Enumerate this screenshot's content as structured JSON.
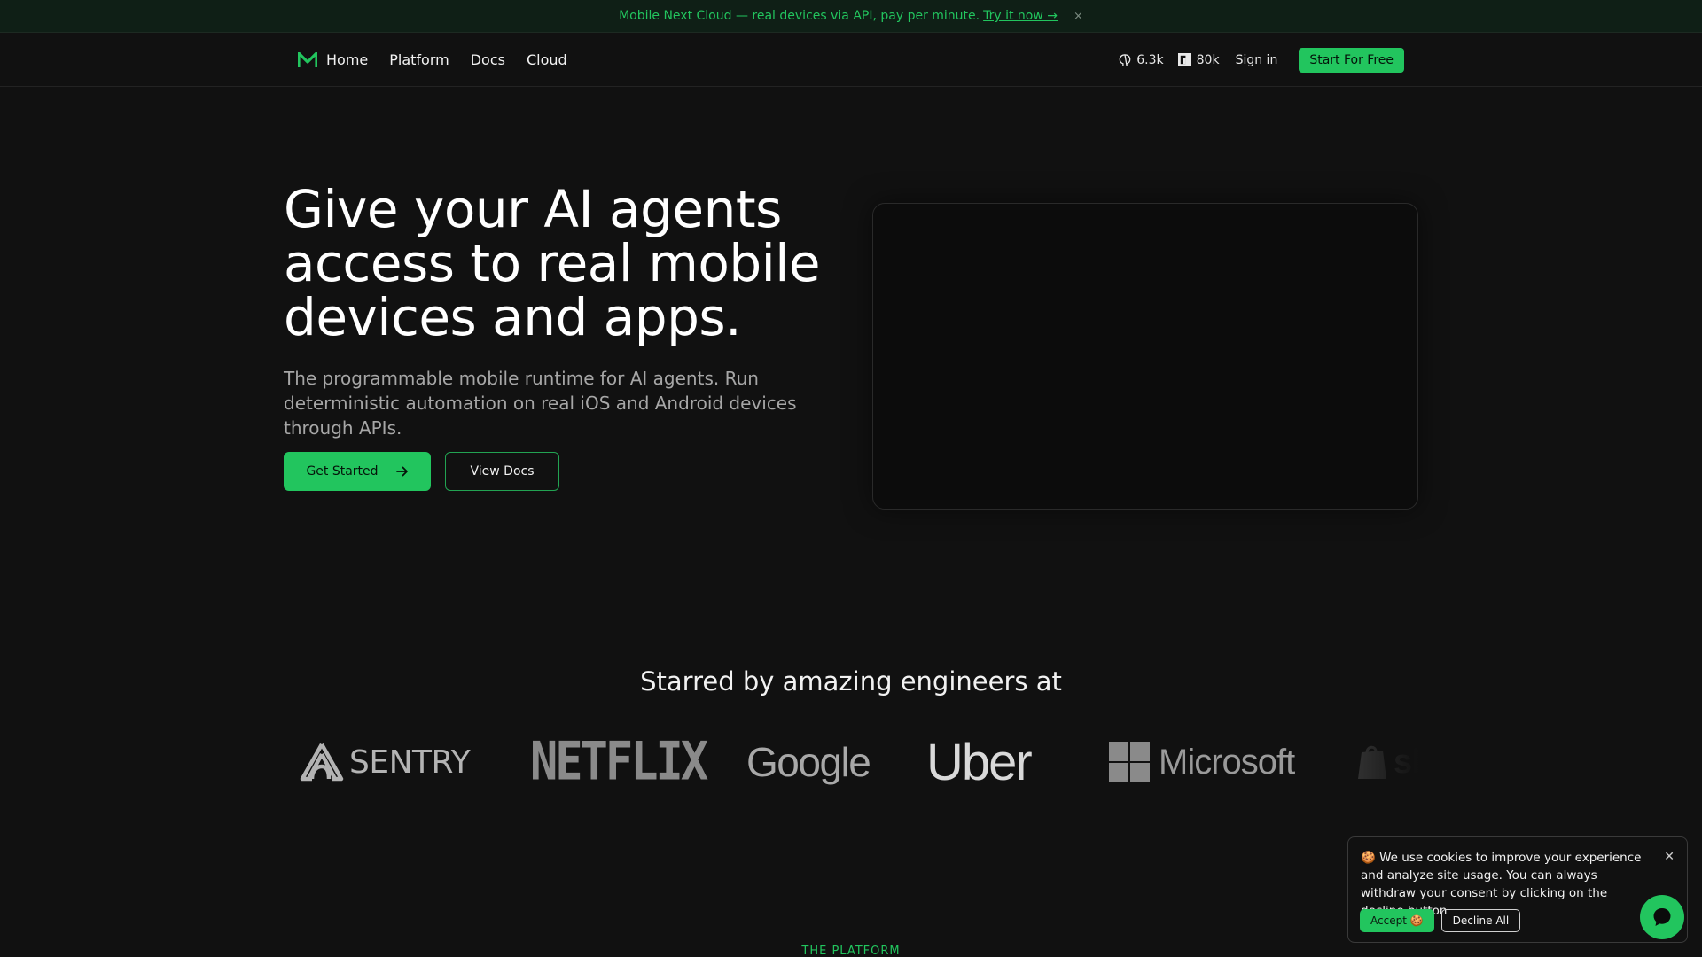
{
  "announcement": {
    "text": "Mobile Next Cloud — real devices via API, pay per minute.",
    "link": "Try it now →",
    "close": "×"
  },
  "nav": {
    "home": "Home",
    "links": [
      "Platform",
      "Docs",
      "Cloud"
    ],
    "github_stars": "6.3k",
    "npm_downloads": "80k",
    "signin": "Sign in",
    "cta": "Start For Free"
  },
  "hero": {
    "title": "Give your AI agents access to real mobile devices and apps.",
    "subtitle": "The programmable mobile runtime for AI agents. Run deterministic automation on real iOS and Android devices through APIs.",
    "primary_button": "Get Started",
    "secondary_button": "View Docs"
  },
  "logos": {
    "heading": "Starred by amazing engineers at",
    "items": [
      "SENTRY",
      "NETFLIX",
      "Google",
      "Uber",
      "Microsoft",
      "shopify"
    ]
  },
  "platform_label": "THE PLATFORM",
  "cookie": {
    "text": "🍪 We use cookies to improve your experience and analyze site usage. You can always withdraw your consent by clicking on the decline button",
    "accept": "Accept 🍪",
    "decline": "Decline All",
    "close": "✕"
  },
  "colors": {
    "accent": "#22c55e",
    "background": "#111111"
  }
}
